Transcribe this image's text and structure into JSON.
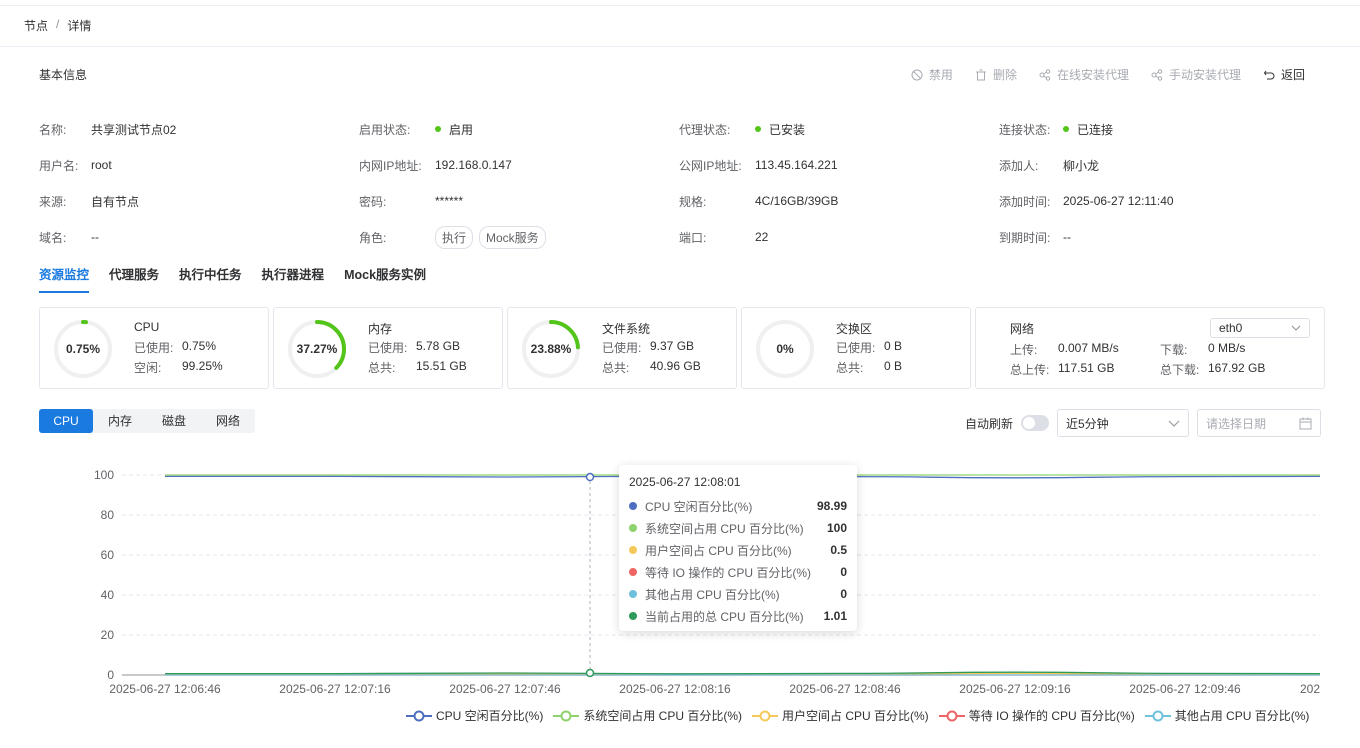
{
  "breadcrumb": {
    "root": "节点",
    "sep": "/",
    "current": "详情"
  },
  "section_title": "基本信息",
  "actions": [
    {
      "label": "禁用",
      "icon": "ban-icon",
      "active": false
    },
    {
      "label": "删除",
      "icon": "trash-icon",
      "active": false
    },
    {
      "label": "在线安装代理",
      "icon": "share-icon",
      "active": false
    },
    {
      "label": "手动安装代理",
      "icon": "share-icon",
      "active": false
    },
    {
      "label": "返回",
      "icon": "return-icon",
      "active": true
    }
  ],
  "info": {
    "name_label": "名称:",
    "name": "共享测试节点02",
    "enable_label": "启用状态:",
    "enable": "启用",
    "agent_label": "代理状态:",
    "agent": "已安装",
    "conn_label": "连接状态:",
    "conn": "已连接",
    "user_label": "用户名:",
    "user": "root",
    "lan_label": "内网IP地址:",
    "lan": "192.168.0.147",
    "wan_label": "公网IP地址:",
    "wan": "113.45.164.221",
    "adder_label": "添加人:",
    "adder": "柳小龙",
    "source_label": "来源:",
    "source": "自有节点",
    "pwd_label": "密码:",
    "pwd": "******",
    "spec_label": "规格:",
    "spec": "4C/16GB/39GB",
    "addtime_label": "添加时间:",
    "addtime": "2025-06-27 12:11:40",
    "domain_label": "域名:",
    "domain": "--",
    "role_label": "角色:",
    "role_tags": [
      "执行",
      "Mock服务"
    ],
    "port_label": "端口:",
    "port": "22",
    "expire_label": "到期时间:",
    "expire": "--"
  },
  "tabs": [
    "资源监控",
    "代理服务",
    "执行中任务",
    "执行器进程",
    "Mock服务实例"
  ],
  "cards": {
    "cpu": {
      "title": "CPU",
      "percent": "0.75%",
      "fraction": 0.0075,
      "k1": "已使用:",
      "v1": "0.75%",
      "k2": "空闲:",
      "v2": "99.25%"
    },
    "mem": {
      "title": "内存",
      "percent": "37.27%",
      "fraction": 0.3727,
      "k1": "已使用:",
      "v1": "5.78 GB",
      "k2": "总共:",
      "v2": "15.51 GB"
    },
    "fs": {
      "title": "文件系统",
      "percent": "23.88%",
      "fraction": 0.2388,
      "k1": "已使用:",
      "v1": "9.37 GB",
      "k2": "总共:",
      "v2": "40.96 GB"
    },
    "swap": {
      "title": "交换区",
      "percent": "0%",
      "fraction": 0,
      "k1": "已使用:",
      "v1": "0 B",
      "k2": "总共:",
      "v2": "0 B"
    },
    "net": {
      "title": "网络",
      "iface": "eth0",
      "up_label": "上传:",
      "up": "0.007 MB/s",
      "down_label": "下载:",
      "down": "0 MB/s",
      "totup_label": "总上传:",
      "totup": "117.51 GB",
      "totdown_label": "总下载:",
      "totdown": "167.92 GB"
    }
  },
  "segments": [
    "CPU",
    "内存",
    "磁盘",
    "网络"
  ],
  "controls": {
    "auto_refresh": "自动刷新",
    "range": "近5分钟",
    "date_placeholder": "请选择日期"
  },
  "tooltip": {
    "time": "2025-06-27 12:08:01",
    "rows": [
      {
        "name": "CPU 空闲百分比(%)",
        "value": "98.99",
        "color": "#4e6fbf"
      },
      {
        "name": "系统空间占用 CPU 百分比(%)",
        "value": "100",
        "color": "#8fd16d"
      },
      {
        "name": "用户空间占 CPU 百分比(%)",
        "value": "0.5",
        "color": "#f5c85a"
      },
      {
        "name": "等待 IO 操作的 CPU 百分比(%)",
        "value": "0",
        "color": "#ef6464"
      },
      {
        "name": "其他占用 CPU 百分比(%)",
        "value": "0",
        "color": "#6fc0dc"
      },
      {
        "name": "当前占用的总 CPU 百分比(%)",
        "value": "1.01",
        "color": "#2e9a5c"
      }
    ]
  },
  "chart_data": {
    "type": "line",
    "x": [
      "2025-06-27 12:06:46",
      "2025-06-27 12:07:16",
      "2025-06-27 12:07:46",
      "2025-06-27 12:08:16",
      "2025-06-27 12:08:46",
      "2025-06-27 12:09:16",
      "2025-06-27 12:09:46",
      "202"
    ],
    "yticks": [
      0,
      20,
      40,
      60,
      80,
      100
    ],
    "ylim": [
      0,
      100
    ],
    "series": [
      {
        "name": "CPU 空闲百分比(%)",
        "color": "#4e6fbf",
        "values": [
          99.3,
          99.3,
          98.99,
          99.4,
          99.2,
          98.6,
          99.2,
          99.3
        ]
      },
      {
        "name": "系统空间占用 CPU 百分比(%)",
        "color": "#8fd16d",
        "values": [
          100,
          100,
          100,
          100,
          100,
          100,
          100,
          100
        ]
      },
      {
        "name": "用户空间占 CPU 百分比(%)",
        "color": "#f5c85a",
        "values": [
          0.4,
          0.4,
          0.5,
          0.3,
          0.4,
          0.8,
          0.4,
          0.4
        ]
      },
      {
        "name": "等待 IO 操作的 CPU 百分比(%)",
        "color": "#ef6464",
        "values": [
          0,
          0,
          0,
          0,
          0,
          0,
          0,
          0
        ]
      },
      {
        "name": "其他占用 CPU 百分比(%)",
        "color": "#6fc0dc",
        "values": [
          0,
          0,
          0,
          0,
          0,
          0,
          0,
          0
        ]
      },
      {
        "name": "当前占用的总 CPU 百分比(%)",
        "color": "#2e9a5c",
        "values": [
          0.7,
          0.7,
          1.01,
          0.6,
          0.8,
          1.4,
          0.8,
          0.7
        ]
      }
    ]
  },
  "legend": [
    "CPU 空闲百分比(%)",
    "系统空间占用 CPU 百分比(%)",
    "用户空间占 CPU 百分比(%)",
    "等待 IO 操作的 CPU 百分比(%)",
    "其他占用 CPU 百分比(%)"
  ]
}
